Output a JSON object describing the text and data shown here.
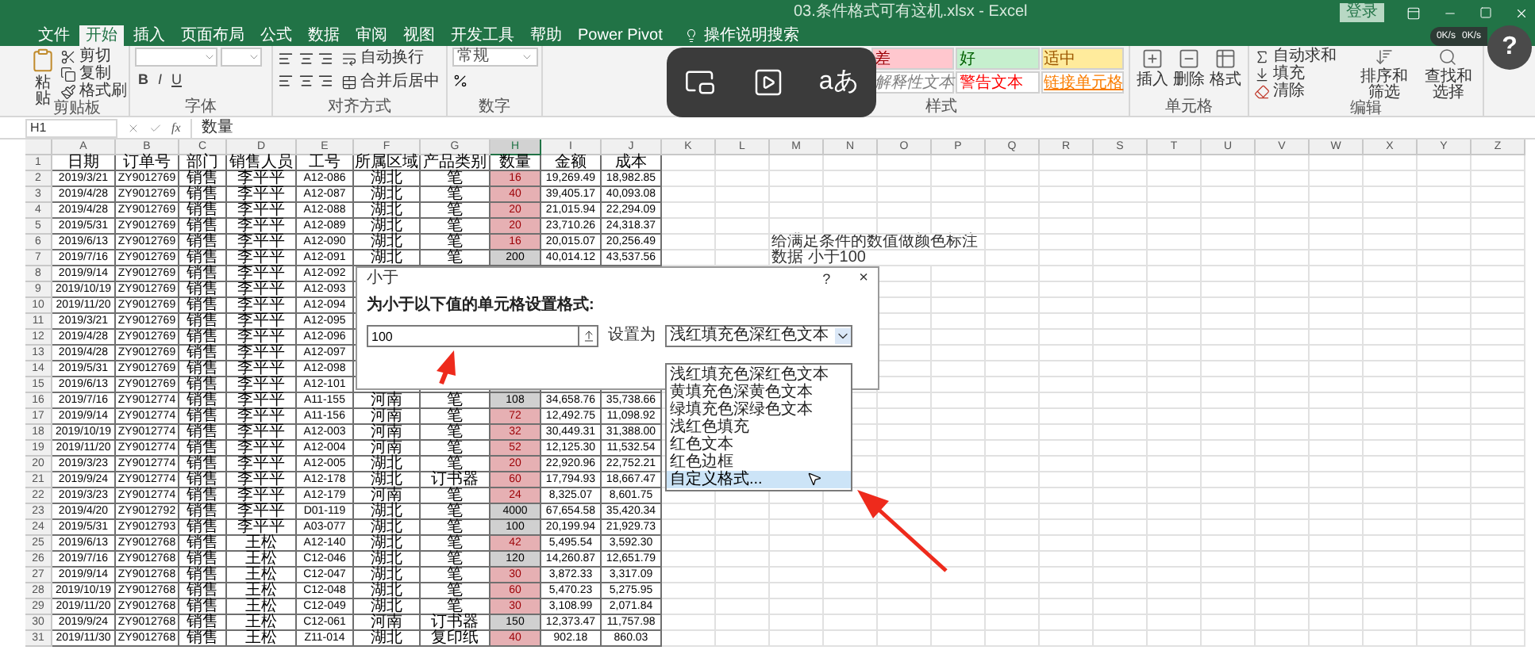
{
  "title_bar": {
    "file_title": "03.条件格式可有这机.xlsx  -  Excel",
    "login_button": "登录"
  },
  "tabs": [
    {
      "label": "文件",
      "selected": false
    },
    {
      "label": "开始",
      "selected": true
    },
    {
      "label": "插入",
      "selected": false
    },
    {
      "label": "页面布局",
      "selected": false
    },
    {
      "label": "公式",
      "selected": false
    },
    {
      "label": "数据",
      "selected": false
    },
    {
      "label": "审阅",
      "selected": false
    },
    {
      "label": "视图",
      "selected": false
    },
    {
      "label": "开发工具",
      "selected": false
    },
    {
      "label": "帮助",
      "selected": false
    },
    {
      "label": "Power Pivot",
      "selected": false
    }
  ],
  "tell_me": "操作说明搜索",
  "net_speed": [
    "0K/s",
    "0K/s"
  ],
  "help_button": "?",
  "overlay": {
    "translate_label": "aあ"
  },
  "ribbon": [
    {
      "kind": "clipboard",
      "label": "剪贴板",
      "items": [
        "粘贴",
        "剪切",
        "复制",
        "格式刷"
      ]
    },
    {
      "kind": "font",
      "label": "字体",
      "items": [
        "B",
        "I",
        "U"
      ]
    },
    {
      "kind": "alignment",
      "label": "对齐方式",
      "items": [
        "自动换行",
        "合并后居中"
      ]
    },
    {
      "kind": "number",
      "label": "数字",
      "items": [
        "常规"
      ]
    },
    {
      "kind": "styles",
      "label": "样式",
      "items": [
        "差",
        "好",
        "适中",
        "解释性文本",
        "警告文本",
        "链接单元格"
      ]
    },
    {
      "kind": "cells",
      "label": "单元格",
      "items": [
        "插入",
        "删除",
        "格式"
      ]
    },
    {
      "kind": "editing",
      "label": "编辑",
      "items": [
        "自动求和",
        "填充",
        "清除",
        "排序和筛选",
        "查找和选择"
      ]
    }
  ],
  "formula_bar": {
    "name_box": "H1",
    "fx": "fx",
    "formula": "数量"
  },
  "columns": [
    {
      "label": "A",
      "selected": false
    },
    {
      "label": "B",
      "selected": false
    },
    {
      "label": "C",
      "selected": false
    },
    {
      "label": "D",
      "selected": false
    },
    {
      "label": "E",
      "selected": false
    },
    {
      "label": "F",
      "selected": false
    },
    {
      "label": "G",
      "selected": false
    },
    {
      "label": "H",
      "selected": true
    },
    {
      "label": "I",
      "selected": false
    },
    {
      "label": "J",
      "selected": false
    },
    {
      "label": "K",
      "selected": false
    },
    {
      "label": "L",
      "selected": false
    },
    {
      "label": "M",
      "selected": false
    },
    {
      "label": "N",
      "selected": false
    },
    {
      "label": "O",
      "selected": false
    },
    {
      "label": "P",
      "selected": false
    },
    {
      "label": "Q",
      "selected": false
    },
    {
      "label": "R",
      "selected": false
    },
    {
      "label": "S",
      "selected": false
    },
    {
      "label": "T",
      "selected": false
    },
    {
      "label": "U",
      "selected": false
    },
    {
      "label": "V",
      "selected": false
    },
    {
      "label": "W",
      "selected": false
    },
    {
      "label": "X",
      "selected": false
    },
    {
      "label": "Y",
      "selected": false
    },
    {
      "label": "Z",
      "selected": false
    }
  ],
  "rows": [
    {
      "number": "1",
      "cells": [
        "日期",
        "订单号",
        "部门",
        "销售人员",
        "工号",
        "所属区域",
        "产品类别",
        "数量",
        "金额",
        "成本"
      ]
    },
    {
      "number": "2",
      "highlighted": true,
      "cells": [
        "2019/3/21",
        "ZY9012769",
        "销售",
        "李平平",
        "A12-086",
        "湖北",
        "笔",
        "16",
        "19,269.49",
        "18,982.85"
      ]
    },
    {
      "number": "3",
      "highlighted": true,
      "cells": [
        "2019/4/28",
        "ZY9012769",
        "销售",
        "李平平",
        "A12-087",
        "湖北",
        "笔",
        "40",
        "39,405.17",
        "40,093.08"
      ]
    },
    {
      "number": "4",
      "highlighted": true,
      "cells": [
        "2019/4/28",
        "ZY9012769",
        "销售",
        "李平平",
        "A12-088",
        "湖北",
        "笔",
        "20",
        "21,015.94",
        "22,294.09"
      ]
    },
    {
      "number": "5",
      "highlighted": true,
      "cells": [
        "2019/5/31",
        "ZY9012769",
        "销售",
        "李平平",
        "A12-089",
        "湖北",
        "笔",
        "20",
        "23,710.26",
        "24,318.37"
      ]
    },
    {
      "number": "6",
      "highlighted": true,
      "cells": [
        "2019/6/13",
        "ZY9012769",
        "销售",
        "李平平",
        "A12-090",
        "湖北",
        "笔",
        "16",
        "20,015.07",
        "20,256.49"
      ],
      "note": "给满足条件的数值做颜色标注"
    },
    {
      "number": "7",
      "highlighted": false,
      "cells": [
        "2019/7/16",
        "ZY9012769",
        "销售",
        "李平平",
        "A12-091",
        "湖北",
        "笔",
        "200",
        "40,014.12",
        "43,537.56"
      ],
      "note": "数据 小于100"
    },
    {
      "number": "8",
      "cells": [
        "2019/9/14",
        "ZY9012769",
        "销售",
        "李平平",
        "A12-092"
      ]
    },
    {
      "number": "9",
      "cells": [
        "2019/10/19",
        "ZY9012769",
        "销售",
        "李平平",
        "A12-093"
      ]
    },
    {
      "number": "10",
      "cells": [
        "2019/11/20",
        "ZY9012769",
        "销售",
        "李平平",
        "A12-094"
      ]
    },
    {
      "number": "11",
      "cells": [
        "2019/3/21",
        "ZY9012769",
        "销售",
        "李平平",
        "A12-095"
      ]
    },
    {
      "number": "12",
      "cells": [
        "2019/4/28",
        "ZY9012769",
        "销售",
        "李平平",
        "A12-096"
      ]
    },
    {
      "number": "13",
      "cells": [
        "2019/4/28",
        "ZY9012769",
        "销售",
        "李平平",
        "A12-097"
      ]
    },
    {
      "number": "14",
      "cells": [
        "2019/5/31",
        "ZY9012769",
        "销售",
        "李平平",
        "A12-098"
      ]
    },
    {
      "number": "15",
      "cells": [
        "2019/6/13",
        "ZY9012769",
        "销售",
        "李平平",
        "A12-101"
      ]
    },
    {
      "number": "16",
      "highlighted": false,
      "cells": [
        "2019/7/16",
        "ZY9012774",
        "销售",
        "李平平",
        "A11-155",
        "河南",
        "笔",
        "108",
        "34,658.76",
        "35,738.66"
      ]
    },
    {
      "number": "17",
      "highlighted": true,
      "cells": [
        "2019/9/14",
        "ZY9012774",
        "销售",
        "李平平",
        "A11-156",
        "河南",
        "笔",
        "72",
        "12,492.75",
        "11,098.92"
      ]
    },
    {
      "number": "18",
      "highlighted": true,
      "cells": [
        "2019/10/19",
        "ZY9012774",
        "销售",
        "李平平",
        "A12-003",
        "河南",
        "笔",
        "32",
        "30,449.31",
        "31,388.00"
      ]
    },
    {
      "number": "19",
      "highlighted": true,
      "cells": [
        "2019/11/20",
        "ZY9012774",
        "销售",
        "李平平",
        "A12-004",
        "河南",
        "笔",
        "52",
        "12,125.30",
        "11,532.54"
      ]
    },
    {
      "number": "20",
      "highlighted": true,
      "cells": [
        "2019/3/23",
        "ZY9012774",
        "销售",
        "李平平",
        "A12-005",
        "湖北",
        "笔",
        "20",
        "22,920.96",
        "22,752.21"
      ]
    },
    {
      "number": "21",
      "highlighted": true,
      "cells": [
        "2019/9/24",
        "ZY9012774",
        "销售",
        "李平平",
        "A12-178",
        "湖北",
        "订书器",
        "60",
        "17,794.93",
        "18,667.47"
      ]
    },
    {
      "number": "22",
      "highlighted": true,
      "cells": [
        "2019/3/23",
        "ZY9012774",
        "销售",
        "李平平",
        "A12-179",
        "河南",
        "笔",
        "24",
        "8,325.07",
        "8,601.75"
      ]
    },
    {
      "number": "23",
      "highlighted": false,
      "cells": [
        "2019/4/20",
        "ZY9012792",
        "销售",
        "李平平",
        "D01-119",
        "湖北",
        "笔",
        "4000",
        "67,654.58",
        "35,420.34"
      ]
    },
    {
      "number": "24",
      "highlighted": false,
      "cells": [
        "2019/5/31",
        "ZY9012793",
        "销售",
        "李平平",
        "A03-077",
        "湖北",
        "笔",
        "100",
        "20,199.94",
        "21,929.73"
      ]
    },
    {
      "number": "25",
      "highlighted": true,
      "cells": [
        "2019/6/13",
        "ZY9012768",
        "销售",
        "王松",
        "A12-140",
        "湖北",
        "笔",
        "42",
        "5,495.54",
        "3,592.30"
      ]
    },
    {
      "number": "26",
      "highlighted": false,
      "cells": [
        "2019/7/16",
        "ZY9012768",
        "销售",
        "王松",
        "C12-046",
        "湖北",
        "笔",
        "120",
        "14,260.87",
        "12,651.79"
      ]
    },
    {
      "number": "27",
      "highlighted": true,
      "cells": [
        "2019/9/14",
        "ZY9012768",
        "销售",
        "王松",
        "C12-047",
        "湖北",
        "笔",
        "30",
        "3,872.33",
        "3,317.09"
      ]
    },
    {
      "number": "28",
      "highlighted": true,
      "cells": [
        "2019/10/19",
        "ZY9012768",
        "销售",
        "王松",
        "C12-048",
        "湖北",
        "笔",
        "60",
        "5,470.23",
        "5,275.95"
      ]
    },
    {
      "number": "29",
      "highlighted": true,
      "cells": [
        "2019/11/20",
        "ZY9012768",
        "销售",
        "王松",
        "C12-049",
        "湖北",
        "笔",
        "30",
        "3,108.99",
        "2,071.84"
      ]
    },
    {
      "number": "30",
      "highlighted": false,
      "cells": [
        "2019/9/24",
        "ZY9012768",
        "销售",
        "王松",
        "C12-061",
        "河南",
        "订书器",
        "150",
        "12,373.47",
        "11,757.98"
      ]
    },
    {
      "number": "31",
      "highlighted": true,
      "cells": [
        "2019/11/30",
        "ZY9012768",
        "销售",
        "王松",
        "Z11-014",
        "湖北",
        "复印纸",
        "40",
        "902.18",
        "860.03"
      ]
    }
  ],
  "dialog": {
    "title": "小于",
    "help": "?",
    "close": "×",
    "prompt": "为小于以下值的单元格设置格式:",
    "value": "100",
    "set_label": "设置为",
    "format": "浅红填充色深红色文本",
    "options": [
      {
        "label": "浅红填充色深红色文本",
        "selected": false
      },
      {
        "label": "黄填充色深黄色文本",
        "selected": false
      },
      {
        "label": "绿填充色深绿色文本",
        "selected": false
      },
      {
        "label": "浅红色填充",
        "selected": false
      },
      {
        "label": "红色文本",
        "selected": false
      },
      {
        "label": "红色边框",
        "selected": false
      },
      {
        "label": "自定义格式...",
        "selected": true
      }
    ]
  }
}
